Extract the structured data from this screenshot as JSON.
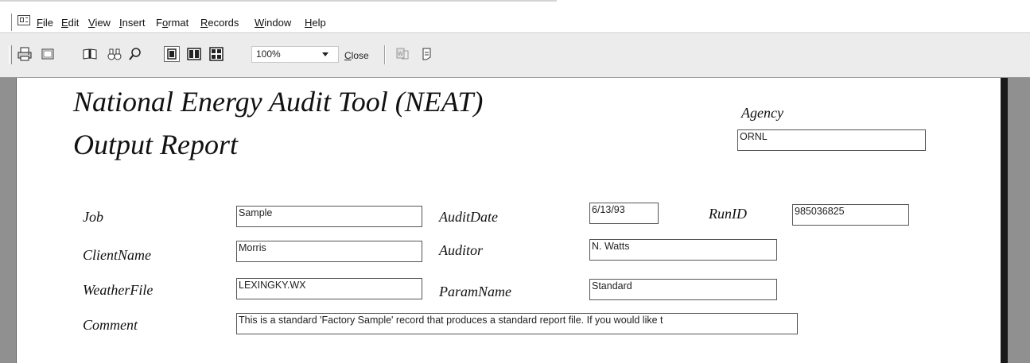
{
  "menu": {
    "items": [
      {
        "label": "File",
        "ul": "F",
        "rest": "ile"
      },
      {
        "label": "Edit",
        "ul": "E",
        "rest": "dit"
      },
      {
        "label": "View",
        "ul": "V",
        "rest": "iew"
      },
      {
        "label": "Insert",
        "ul": "I",
        "rest": "nsert"
      },
      {
        "label": "Format",
        "pre": "F",
        "ul": "o",
        "rest": "rmat"
      },
      {
        "label": "Records",
        "ul": "R",
        "rest": "ecords"
      },
      {
        "label": "Window",
        "ul": "W",
        "rest": "indow"
      },
      {
        "label": "Help",
        "ul": "H",
        "rest": "elp"
      }
    ]
  },
  "toolbar": {
    "icons": [
      "print-icon",
      "page-setup-icon",
      "open-book-icon",
      "binoculars-icon",
      "zoom-icon",
      "one-page-icon",
      "two-pages-icon",
      "multiple-pages-icon",
      "office-links-icon",
      "database-window-icon"
    ],
    "zoom_value": "100%",
    "close_ul": "C",
    "close_rest": "lose"
  },
  "report": {
    "title_line1": "National Energy Audit Tool (NEAT)",
    "title_line2": "Output Report",
    "agency_label": "Agency",
    "agency_value": "ORNL",
    "job_label": "Job",
    "job_value": "Sample",
    "auditdate_label": "AuditDate",
    "auditdate_value": "6/13/93",
    "runid_label": "RunID",
    "runid_value": "985036825",
    "clientname_label": "ClientName",
    "clientname_value": "Morris",
    "auditor_label": "Auditor",
    "auditor_value": "N. Watts",
    "weatherfile_label": "WeatherFile",
    "weatherfile_value": "LEXINGKY.WX",
    "paramname_label": "ParamName",
    "paramname_value": "Standard",
    "comment_label": "Comment",
    "comment_value": "This is a standard 'Factory Sample' record that produces a standard report file.  If you would like t"
  }
}
